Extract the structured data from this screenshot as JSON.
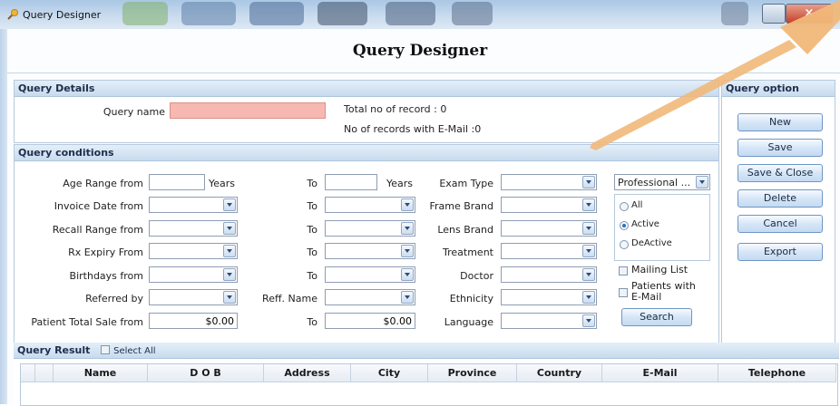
{
  "window": {
    "title": "Query Designer"
  },
  "page_title": "Query Designer",
  "query_details": {
    "header": "Query Details",
    "query_name_label": "Query name",
    "query_name_value": "",
    "total_records": "Total no of record : 0",
    "records_with_email": "No of records with E-Mail :0"
  },
  "query_conditions": {
    "header": "Query conditions",
    "age_from_label": "Age Range from",
    "years_label_1": "Years",
    "to_label": "To",
    "years_label_2": "Years",
    "invoice_date_label": "Invoice Date from",
    "recall_range_label": "Recall Range from",
    "rx_expiry_label": "Rx Expiry From",
    "birthdays_label": "Birthdays from",
    "referred_by_label": "Referred by",
    "reff_name_label": "Reff. Name",
    "total_sale_label": "Patient Total Sale from",
    "total_sale_from": "$0.00",
    "total_sale_to": "$0.00",
    "exam_type_label": "Exam Type",
    "frame_brand_label": "Frame Brand",
    "lens_brand_label": "Lens Brand",
    "treatment_label": "Treatment",
    "doctor_label": "Doctor",
    "ethnicity_label": "Ethnicity",
    "language_label": "Language",
    "professional_value": "Professional ...",
    "status_all": "All",
    "status_active": "Active",
    "status_deactive": "DeActive",
    "selected_status": "Active",
    "mailing_list_label": "Mailing List",
    "patients_email_label_1": "Patients with",
    "patients_email_label_2": "E-Mail",
    "search_button": "Search"
  },
  "query_option": {
    "header": "Query option",
    "buttons": [
      "New",
      "Save",
      "Save & Close",
      "Delete",
      "Cancel",
      "Export"
    ]
  },
  "query_result": {
    "header": "Query Result",
    "select_all_label": "Select All",
    "columns": [
      "Name",
      "D O B",
      "Address",
      "City",
      "Province",
      "Country",
      "E-Mail",
      "Telephone"
    ]
  },
  "colors": {
    "panel_header": "#c7dbee",
    "query_name_fill": "#f7b8b2",
    "button_border": "#6f96c4",
    "radio_selected": "#2a6fc0",
    "arrow_fill": "#f1b87a"
  },
  "icons": [
    "app-icon",
    "minimize-icon",
    "close-icon",
    "dropdown-arrow-icon",
    "annotation-arrow"
  ]
}
